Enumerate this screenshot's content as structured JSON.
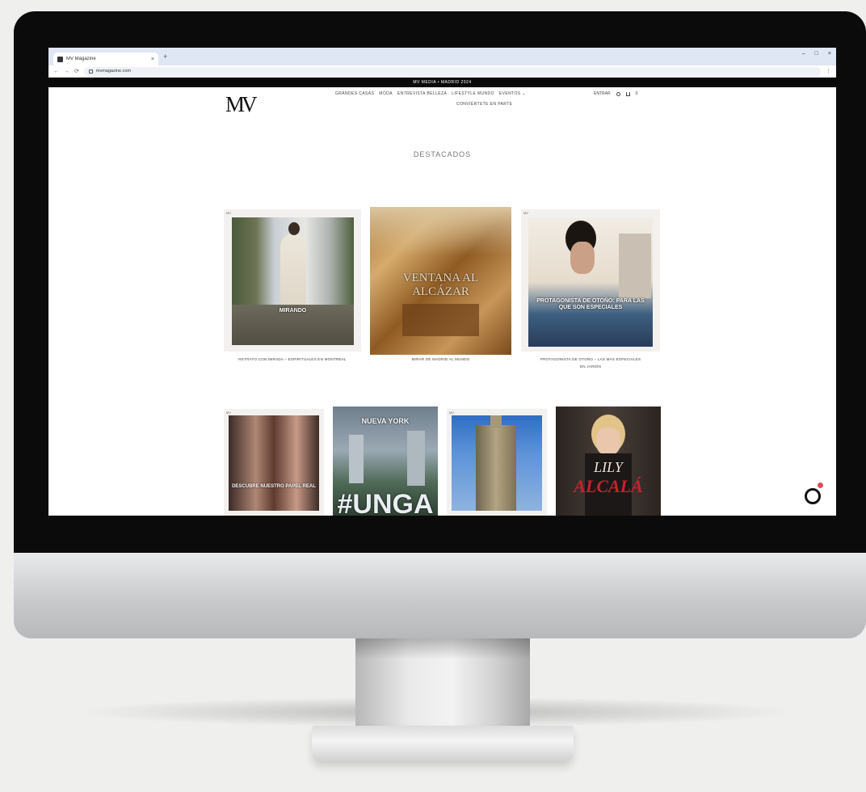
{
  "browser": {
    "tab_title": "MV Magazine",
    "tab_close": "×",
    "new_tab": "+",
    "url": "mvmagazine.com",
    "window_controls": [
      "–",
      "□",
      "×"
    ],
    "nav_back": "←",
    "nav_forward": "→",
    "nav_reload": "⟳",
    "menu": "⋮"
  },
  "site": {
    "announcement": "MV MEDIA • MADRID 2024",
    "logo": "MV",
    "nav": [
      "GRANDES CASAS",
      "MODA",
      "ENTREVISTA BELLEZA",
      "LIFESTYLE MUNDO",
      "EVENTOS ⌄"
    ],
    "nav_sub": "CONVIÉRTETE EN PARTE",
    "header_right": {
      "login": "ENTRAR",
      "cart_count": "0"
    },
    "section_title": "DESTACADOS"
  },
  "cards_row1": [
    {
      "tag": "MV",
      "overlay": "MIRANDO",
      "caption": "RETRATO CON MIRADA – ESPIRITUALES EN MONTREAL",
      "caption2": ""
    },
    {
      "tag": "",
      "overlay": "VENTANA AL ALCÁZAR",
      "caption": "MIRAR DE MADRID AL MUNDO",
      "caption2": ""
    },
    {
      "tag": "MV",
      "overlay": "PROTAGONISTA DE OTOÑO: PARA LAS QUE SON ESPECIALES",
      "caption": "PROTAGONISTA DE OTOÑO – LAS MÁS ESPECIALES",
      "caption2": "EN JARDÍN"
    }
  ],
  "cards_row2": [
    {
      "tag": "MV",
      "overlay": "DESCUBRE NUESTRO PAPEL REAL"
    },
    {
      "tag": "",
      "overlay": "NUEVA YORK",
      "overlay2": "#UNGA"
    },
    {
      "tag": "MV",
      "overlay": ""
    },
    {
      "tag": "",
      "overlay": "LILY",
      "overlay2": "ALCALÁ"
    }
  ]
}
